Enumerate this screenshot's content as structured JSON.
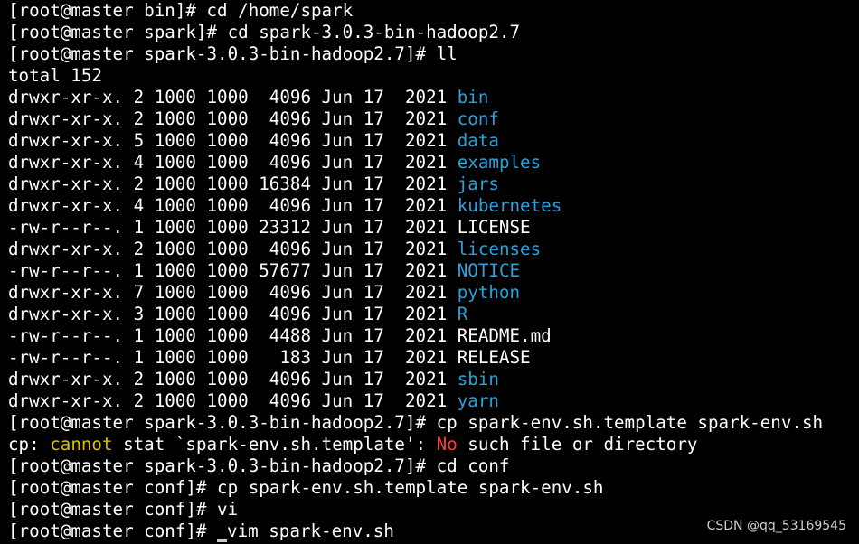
{
  "theme": {
    "background": "#000000",
    "foreground": "#ffffff",
    "directory_color": "#2aa1d8",
    "warning_color": "#d6c000",
    "error_color": "#ff3b3b",
    "watermark_color": "#cfcfcf",
    "cursor_color": "#c8c8c8"
  },
  "terminal": {
    "lines": [
      {
        "segments": [
          {
            "text": "[root@master bin]# cd /home/spark",
            "style": "default"
          }
        ]
      },
      {
        "segments": [
          {
            "text": "[root@master spark]# cd spark-3.0.3-bin-hadoop2.7",
            "style": "default"
          }
        ]
      },
      {
        "segments": [
          {
            "text": "[root@master spark-3.0.3-bin-hadoop2.7]# ll",
            "style": "default"
          }
        ]
      },
      {
        "segments": [
          {
            "text": "total 152",
            "style": "default"
          }
        ]
      },
      {
        "segments": [
          {
            "text": "drwxr-xr-x. 2 1000 1000  4096 Jun 17  2021 ",
            "style": "default"
          },
          {
            "text": "bin",
            "style": "dir"
          }
        ]
      },
      {
        "segments": [
          {
            "text": "drwxr-xr-x. 2 1000 1000  4096 Jun 17  2021 ",
            "style": "default"
          },
          {
            "text": "conf",
            "style": "dir"
          }
        ]
      },
      {
        "segments": [
          {
            "text": "drwxr-xr-x. 5 1000 1000  4096 Jun 17  2021 ",
            "style": "default"
          },
          {
            "text": "data",
            "style": "dir"
          }
        ]
      },
      {
        "segments": [
          {
            "text": "drwxr-xr-x. 4 1000 1000  4096 Jun 17  2021 ",
            "style": "default"
          },
          {
            "text": "examples",
            "style": "dir"
          }
        ]
      },
      {
        "segments": [
          {
            "text": "drwxr-xr-x. 2 1000 1000 16384 Jun 17  2021 ",
            "style": "default"
          },
          {
            "text": "jars",
            "style": "dir"
          }
        ]
      },
      {
        "segments": [
          {
            "text": "drwxr-xr-x. 4 1000 1000  4096 Jun 17  2021 ",
            "style": "default"
          },
          {
            "text": "kubernetes",
            "style": "dir"
          }
        ]
      },
      {
        "segments": [
          {
            "text": "-rw-r--r--. 1 1000 1000 23312 Jun 17  2021 LICENSE",
            "style": "default"
          }
        ]
      },
      {
        "segments": [
          {
            "text": "drwxr-xr-x. 2 1000 1000  4096 Jun 17  2021 ",
            "style": "default"
          },
          {
            "text": "licenses",
            "style": "dir"
          }
        ]
      },
      {
        "segments": [
          {
            "text": "-rw-r--r--. 1 1000 1000 57677 Jun 17  2021 ",
            "style": "default"
          },
          {
            "text": "NOTICE",
            "style": "dir"
          }
        ]
      },
      {
        "segments": [
          {
            "text": "drwxr-xr-x. 7 1000 1000  4096 Jun 17  2021 ",
            "style": "default"
          },
          {
            "text": "python",
            "style": "dir"
          }
        ]
      },
      {
        "segments": [
          {
            "text": "drwxr-xr-x. 3 1000 1000  4096 Jun 17  2021 ",
            "style": "default"
          },
          {
            "text": "R",
            "style": "dir"
          }
        ]
      },
      {
        "segments": [
          {
            "text": "-rw-r--r--. 1 1000 1000  4488 Jun 17  2021 README.md",
            "style": "default"
          }
        ]
      },
      {
        "segments": [
          {
            "text": "-rw-r--r--. 1 1000 1000   183 Jun 17  2021 RELEASE",
            "style": "default"
          }
        ]
      },
      {
        "segments": [
          {
            "text": "drwxr-xr-x. 2 1000 1000  4096 Jun 17  2021 ",
            "style": "default"
          },
          {
            "text": "sbin",
            "style": "dir"
          }
        ]
      },
      {
        "segments": [
          {
            "text": "drwxr-xr-x. 2 1000 1000  4096 Jun 17  2021 ",
            "style": "default"
          },
          {
            "text": "yarn",
            "style": "dir"
          }
        ]
      },
      {
        "segments": [
          {
            "text": "[root@master spark-3.0.3-bin-hadoop2.7]# cp spark-env.sh.template spark-env.sh",
            "style": "default"
          }
        ]
      },
      {
        "segments": [
          {
            "text": "cp: ",
            "style": "default"
          },
          {
            "text": "cannot",
            "style": "warning"
          },
          {
            "text": " stat `spark-env.sh.template': ",
            "style": "default"
          },
          {
            "text": "No",
            "style": "error"
          },
          {
            "text": " such file or directory",
            "style": "default"
          }
        ]
      },
      {
        "segments": [
          {
            "text": "[root@master spark-3.0.3-bin-hadoop2.7]# cd conf",
            "style": "default"
          }
        ]
      },
      {
        "segments": [
          {
            "text": "[root@master conf]# cp spark-env.sh.template spark-env.sh",
            "style": "default"
          }
        ]
      },
      {
        "segments": [
          {
            "text": "[root@master conf]# vi",
            "style": "default"
          }
        ]
      },
      {
        "segments": [
          {
            "text": "[root@master conf]# ",
            "style": "default"
          },
          {
            "text": "vim spark-env.sh",
            "style": "default"
          }
        ],
        "cursor_after_segment": 0
      }
    ]
  },
  "watermark": {
    "text": "CSDN @qq_53169545"
  }
}
